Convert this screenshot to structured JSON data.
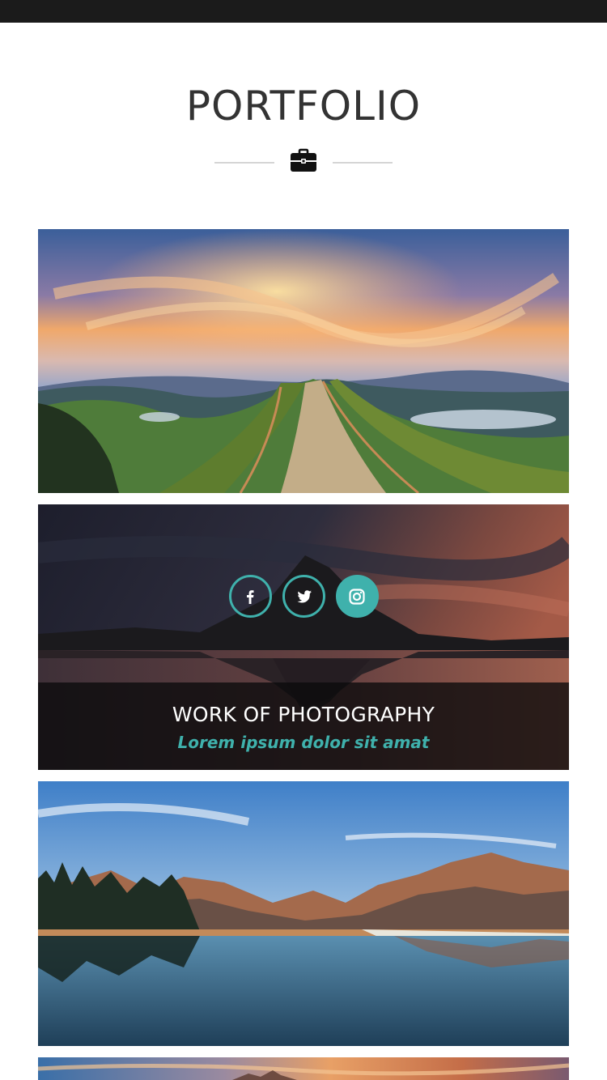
{
  "header": {
    "title": "PORTFOLIO",
    "icon": "briefcase-icon"
  },
  "portfolio": {
    "items": [
      {
        "image": "mountain-ridge-path-sunset-photo"
      },
      {
        "image": "mountain-lake-reflection-dusk-photo",
        "overlay": {
          "social": [
            "facebook-icon",
            "twitter-icon",
            "instagram-icon"
          ],
          "title": "WORK OF PHOTOGRAPHY",
          "subtitle": "Lorem ipsum dolor sit amat"
        }
      },
      {
        "image": "alpine-lake-blue-sky-photo"
      },
      {
        "image": "sunset-landscape-photo"
      }
    ]
  },
  "colors": {
    "accent": "#3fb1ac",
    "topbar": "#1b1b1b",
    "title": "#333333"
  }
}
